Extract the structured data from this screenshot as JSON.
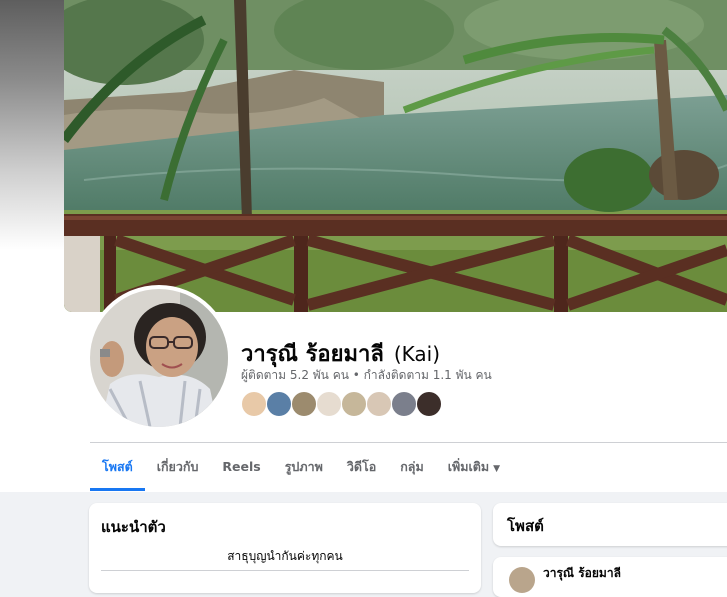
{
  "profile": {
    "name": "วารุณี ร้อยมาลี",
    "nickname": "(Kai)",
    "stats": "ผู้ติดตาม 5.2 พัน คน • กำลังติดตาม 1.1 พัน คน",
    "friend_avatar_icons": [
      "friend-avatar-1",
      "friend-avatar-2",
      "friend-avatar-3",
      "friend-avatar-4",
      "friend-avatar-5",
      "friend-avatar-6",
      "friend-avatar-7",
      "friend-avatar-8"
    ]
  },
  "tabs": [
    {
      "label": "โพสต์",
      "active": true
    },
    {
      "label": "เกี่ยวกับ"
    },
    {
      "label": "Reels"
    },
    {
      "label": "รูปภาพ"
    },
    {
      "label": "วิดีโอ"
    },
    {
      "label": "กลุ่ม"
    },
    {
      "label": "เพิ่มเติม",
      "caret": "▼"
    }
  ],
  "intro": {
    "title": "แนะนำตัว",
    "bio": "สาธุบุญนำกันค่ะทุกคน"
  },
  "posts": {
    "title": "โพสต์",
    "author": "วารุณี ร้อยมาลี"
  },
  "colors": {
    "accent": "#1877f2",
    "text_secondary": "#65676b",
    "page_bg": "#f0f2f5"
  }
}
